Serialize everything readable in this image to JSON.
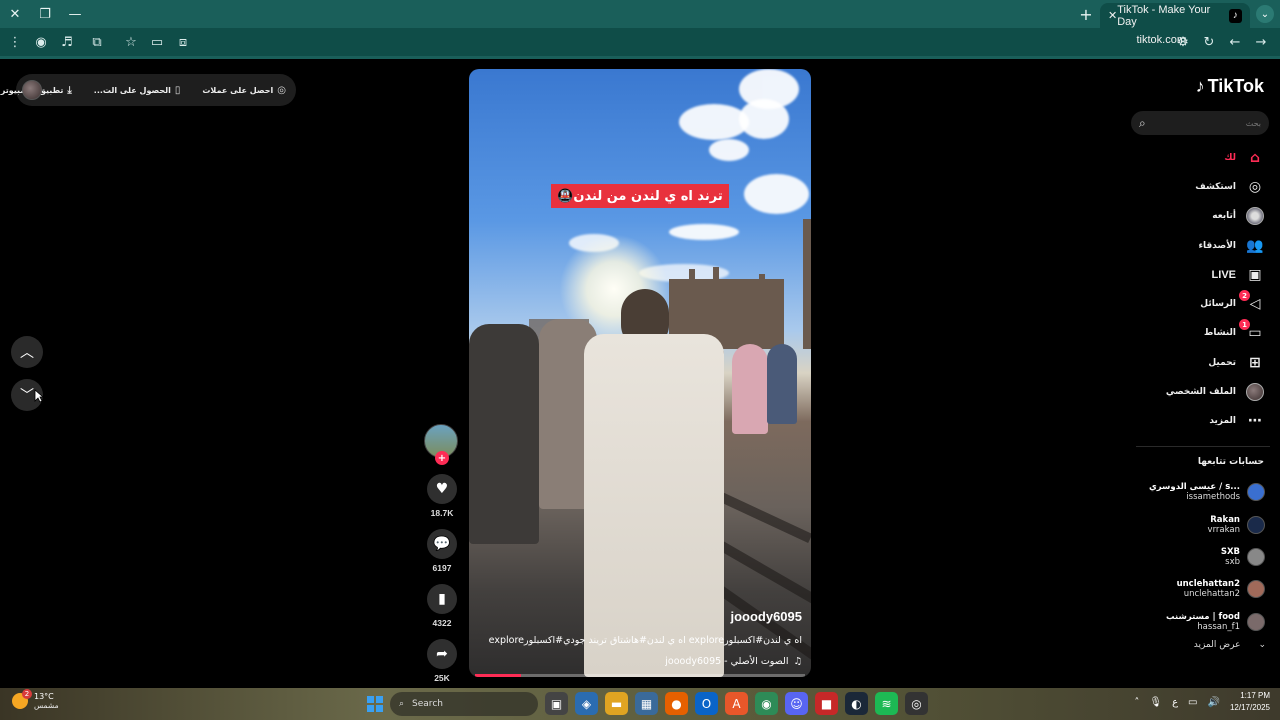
{
  "browser": {
    "tab_title": "TikTok - Make Your Day",
    "url": "tiktok.com",
    "new_tab": "+",
    "close_tab": "✕",
    "tab_menu": "⌄"
  },
  "top_bar": {
    "get_coins": "احصل على عملات",
    "get_app": "الحصول على الت...",
    "desktop_app": "تطبيق الكمبيوتر"
  },
  "video": {
    "banner_text": "ترند اه ي لندن من لندن🚇",
    "author": "jooody6095",
    "caption": "اه ي لندن#اكسبلورexplore اه ي لندن#هاشتاق  تريند جودي#اكسبلورexplore",
    "music": "الصوت الأصلي - jooody6095",
    "music_icon": "♫",
    "progress_fraction": 0.14
  },
  "actions": {
    "likes": "18.7K",
    "comments": "6197",
    "saves": "4322",
    "shares": "25K"
  },
  "sidebar": {
    "logo_text": "TikTok",
    "search_placeholder": "بحث",
    "nav": [
      {
        "label": "لك",
        "icon": "home-icon"
      },
      {
        "label": "استكشف",
        "icon": "compass-icon"
      },
      {
        "label": "أتابعه",
        "icon": "following-icon"
      },
      {
        "label": "الأصدقاء",
        "icon": "friends-icon"
      },
      {
        "label": "LIVE",
        "icon": "live-icon"
      },
      {
        "label": "الرسائل",
        "icon": "messages-icon",
        "badge": "2"
      },
      {
        "label": "النشاط",
        "icon": "activity-icon",
        "badge": "1"
      },
      {
        "label": "تحميل",
        "icon": "upload-icon"
      },
      {
        "label": "الملف الشخصي",
        "icon": "profile-icon"
      },
      {
        "label": "المزيد",
        "icon": "more-icon"
      }
    ],
    "following_title": "حسابات تتابعها",
    "following": [
      {
        "name": "عيسى الدوسري / s...",
        "handle": "issamethods",
        "color": "#3a6fd0"
      },
      {
        "name": "Rakan",
        "handle": "vrrakan",
        "color": "#1a2a4a"
      },
      {
        "name": "SXB",
        "handle": "sxb",
        "color": "#888888"
      },
      {
        "name": "unclehattan2",
        "handle": "unclehattan2",
        "color": "#a06a5a"
      },
      {
        "name": "مسترشنب | food",
        "handle": "hassan_f1",
        "color": "#7a6a6a"
      }
    ],
    "see_more": "عرض المزيد"
  },
  "taskbar": {
    "temperature": "13°C",
    "weather_desc": "مشمس",
    "weather_badge": "2",
    "search": "Search",
    "time": "1:17 PM",
    "date": "12/17/2025",
    "lang": "ع"
  }
}
